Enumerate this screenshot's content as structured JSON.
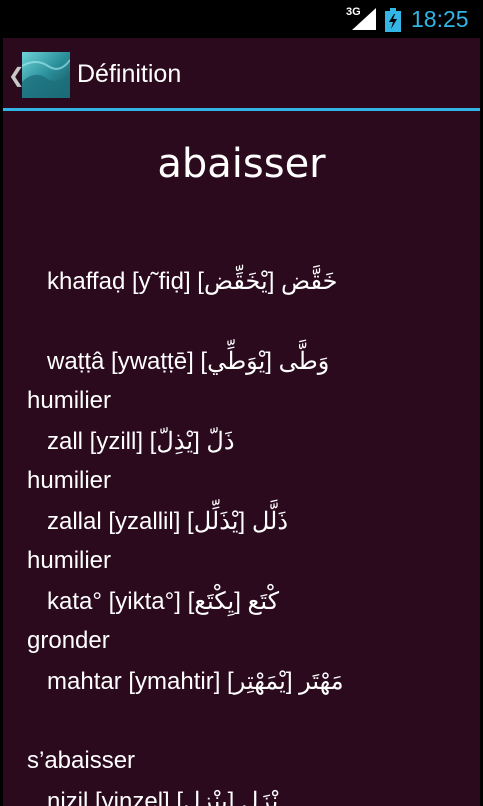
{
  "status_bar": {
    "network": "3G",
    "time": "18:25"
  },
  "action_bar": {
    "title": "Définition",
    "up_icon": "chevron-left-icon",
    "app_icon": "app-logo-icon"
  },
  "colors": {
    "background": "#2b0a1d",
    "accent": "#33b5e5",
    "text": "#ffffff"
  },
  "definition": {
    "headword": "abaisser",
    "lines": [
      {
        "kind": "entry",
        "text": "khaffaḍ [y˜fiḍ] [يْخَقِّض] خَقَّض"
      },
      {
        "kind": "entry",
        "text": "waṭṭâ [ywaṭṭē] [يْوَطِّي] وَطَّى"
      },
      {
        "kind": "gloss",
        "text": "humilier"
      },
      {
        "kind": "entry",
        "text": "zall [yzill]   [يْذِلّ] ذَلّ"
      },
      {
        "kind": "gloss",
        "text": "humilier"
      },
      {
        "kind": "entry",
        "text": "zallal [yzallil]   [يْذَلِّل] ذَلَّل"
      },
      {
        "kind": "gloss",
        "text": "humilier"
      },
      {
        "kind": "entry",
        "text": "kata° [yikta°]   [يِكْتَع] كْتَع"
      },
      {
        "kind": "gloss",
        "text": "gronder"
      },
      {
        "kind": "entry",
        "text": "mahtar [ymahtir]   [يْمَهْتِر] مَهْتَر"
      },
      {
        "kind": "gloss",
        "text": "s’abaisser"
      },
      {
        "kind": "entry",
        "text": "nizil  [yinzel]  [يِنْزِل] نْزَل"
      }
    ]
  }
}
